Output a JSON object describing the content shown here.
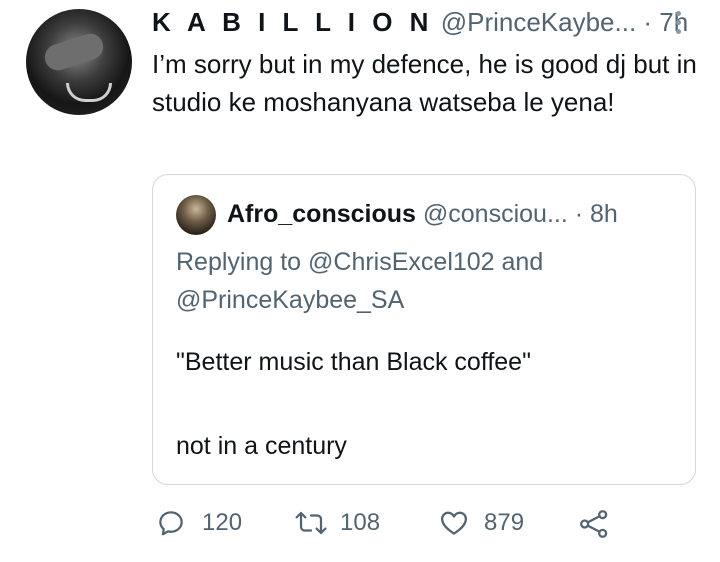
{
  "tweet": {
    "display_name": "K A B I L L I O N",
    "handle": "@PrinceKaybe...",
    "time": "· 7h",
    "text": "I’m sorry but in my defence, he is good dj but in studio ke moshanyana watseba le yena!"
  },
  "quoted_tweet": {
    "display_name": "Afro_conscious",
    "handle": "@consciou...",
    "time": "· 8h",
    "replying_to": "Replying to @ChrisExcel102 and @PrinceKaybee_SA",
    "text_line1": "\"Better music than Black coffee\"",
    "text_line2": "not in a century"
  },
  "actions": {
    "reply_count": "120",
    "retweet_count": "108",
    "like_count": "879"
  },
  "colors": {
    "text": "#0f1419",
    "secondary": "#536471",
    "border": "#cfd9de"
  },
  "icons": [
    "reply-icon",
    "retweet-icon",
    "like-icon",
    "share-icon",
    "more-options-icon"
  ]
}
